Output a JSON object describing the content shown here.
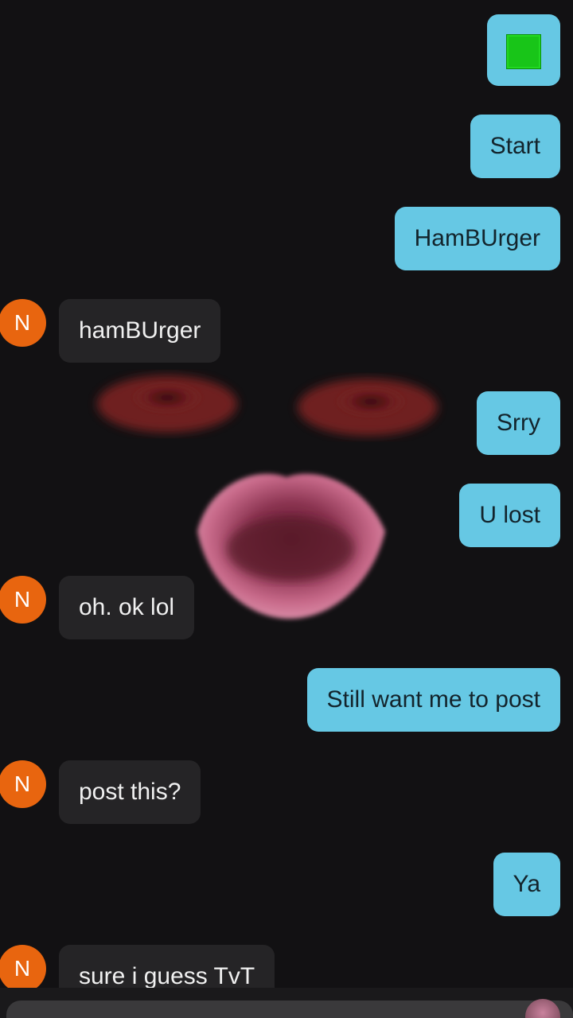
{
  "chat": {
    "contact_initial": "N",
    "messages": [
      {
        "from": "me",
        "text": "Start"
      },
      {
        "from": "me",
        "text": "HamBUrger"
      },
      {
        "from": "them",
        "text": "hamBUrger"
      },
      {
        "from": "me",
        "text": "Srry"
      },
      {
        "from": "me",
        "text": "U lost"
      },
      {
        "from": "them",
        "text": "oh. ok lol"
      },
      {
        "from": "me",
        "text": "Still want me to post"
      },
      {
        "from": "them",
        "text": "post this?"
      },
      {
        "from": "me",
        "text": "Ya"
      },
      {
        "from": "them",
        "text": "sure i guess TvT"
      }
    ],
    "first_message_icon": "green-square-emoji"
  },
  "colors": {
    "background": "#121113",
    "sent_bubble": "#66c8e4",
    "received_bubble": "#252426",
    "avatar": "#e8650f",
    "green_square": "#18c518"
  }
}
